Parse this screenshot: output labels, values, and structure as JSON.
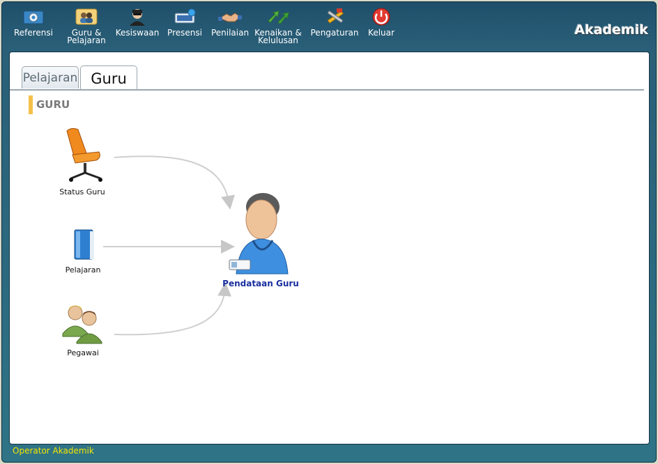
{
  "toolbar": {
    "items": [
      {
        "label": "Referensi",
        "icon": "gear-monitor-icon"
      },
      {
        "label": "Guru & Pelajaran",
        "line1": "Guru &",
        "line2": "Pelajaran",
        "icon": "teacher-group-icon"
      },
      {
        "label": "Kesiswaan",
        "icon": "student-icon"
      },
      {
        "label": "Presensi",
        "icon": "attendance-icon"
      },
      {
        "label": "Penilaian",
        "icon": "handshake-icon"
      },
      {
        "label": "Kenaikan & Kelulusan",
        "line1": "Kenaikan &",
        "line2": "Kelulusan",
        "icon": "arrows-up-icon"
      },
      {
        "label": "Pengaturan",
        "icon": "tools-icon"
      },
      {
        "label": "Keluar",
        "icon": "power-icon"
      }
    ],
    "brand": "Akademik"
  },
  "tabs": [
    {
      "label": "Pelajaran",
      "active": false
    },
    {
      "label": "Guru",
      "active": true
    }
  ],
  "section": {
    "title": "GURU"
  },
  "diagram": {
    "status_guru": "Status Guru",
    "pelajaran": "Pelajaran",
    "pegawai": "Pegawai",
    "pendataan_guru": "Pendataan Guru"
  },
  "footer": {
    "status": "Operator Akademik"
  },
  "colors": {
    "accent": "#f5c04a",
    "frame": "#2a5f78",
    "status_text": "#f4e600",
    "main_label": "#1a2f9e"
  }
}
